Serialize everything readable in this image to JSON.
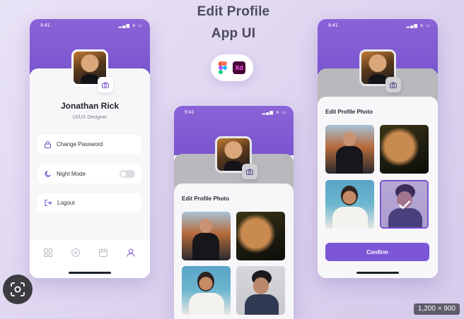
{
  "heading": {
    "line1": "Edit Profile",
    "line2": "App UI"
  },
  "tools": {
    "figma": "figma-logo",
    "xd": "Xd"
  },
  "colors": {
    "accent": "#7a55cf",
    "background": "#e4dcf3",
    "toggle_off": "#dcdce2"
  },
  "profile_screen": {
    "time": "9:41",
    "name": "Jonathan Rick",
    "role": "UI/UX Designer",
    "menu": [
      {
        "label": "Change Password",
        "icon": "lock-icon"
      },
      {
        "label": "Night Mode",
        "icon": "moon-icon",
        "toggle": "off"
      },
      {
        "label": "Logout",
        "icon": "logout-icon"
      }
    ],
    "tabs": [
      "grid-icon",
      "add-icon",
      "calendar-icon",
      "user-icon"
    ],
    "active_tab": "user-icon"
  },
  "edit_screen": {
    "time": "9:41",
    "sheet_title": "Edit Profile Photo",
    "photos": [
      "man-in-black",
      "woman-portrait",
      "woman-white-shirt",
      "man-curly-hair"
    ]
  },
  "confirm_screen": {
    "time": "9:41",
    "sheet_title": "Edit Profile Photo",
    "photos": [
      "man-in-black",
      "woman-portrait",
      "woman-white-shirt",
      "man-curly-hair"
    ],
    "selected_photo": "man-curly-hair",
    "confirm_label": "Confirm"
  },
  "overlay": {
    "size_label": "1,200 × 900"
  }
}
